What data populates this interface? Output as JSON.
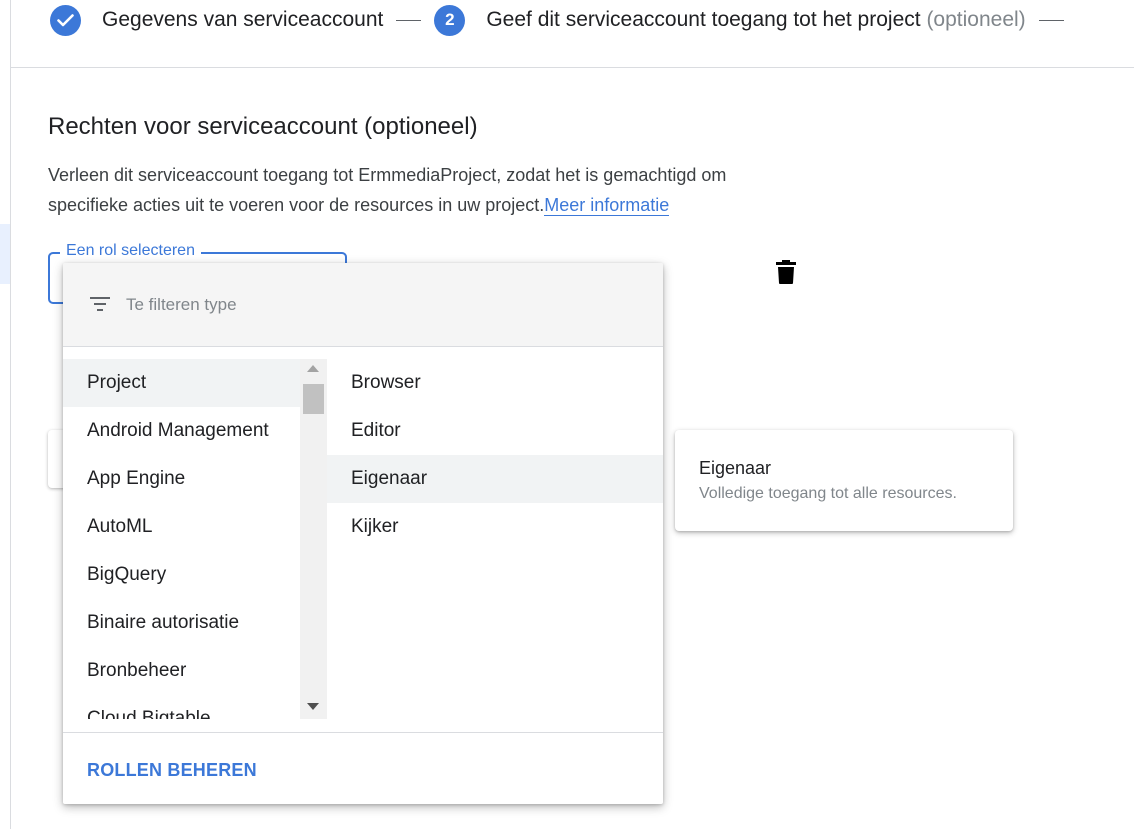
{
  "stepper": {
    "step1": {
      "label": "Gegevens van serviceaccount",
      "status": "completed"
    },
    "step2": {
      "number": "2",
      "label": "Geef dit serviceaccount toegang tot het project",
      "optional": "(optioneel)"
    }
  },
  "section": {
    "title": "Rechten voor serviceaccount (optioneel)",
    "description": "Verleen dit serviceaccount toegang tot ErmmediaProject, zodat het is gemachtigd om specifieke acties uit te voeren voor de resources in uw project.",
    "learn_more": "Meer informatie"
  },
  "role_field": {
    "label": "Een rol selecteren"
  },
  "dropdown": {
    "filter_placeholder": "Te filteren type",
    "categories": [
      {
        "label": "Project",
        "selected": true
      },
      {
        "label": "Android Management"
      },
      {
        "label": "App Engine"
      },
      {
        "label": "AutoML"
      },
      {
        "label": "BigQuery"
      },
      {
        "label": "Binaire autorisatie"
      },
      {
        "label": "Bronbeheer"
      },
      {
        "label": "Cloud Bigtable"
      }
    ],
    "roles": [
      {
        "label": "Browser"
      },
      {
        "label": "Editor"
      },
      {
        "label": "Eigenaar",
        "selected": true
      },
      {
        "label": "Kijker"
      }
    ],
    "manage_roles": "ROLLEN BEHEREN"
  },
  "tooltip": {
    "title": "Eigenaar",
    "description": "Volledige toegang tot alle resources."
  },
  "colors": {
    "accent": "#3c78d8",
    "selected_bg": "#f1f3f4",
    "text_primary": "#202124",
    "text_secondary": "#80868b"
  }
}
